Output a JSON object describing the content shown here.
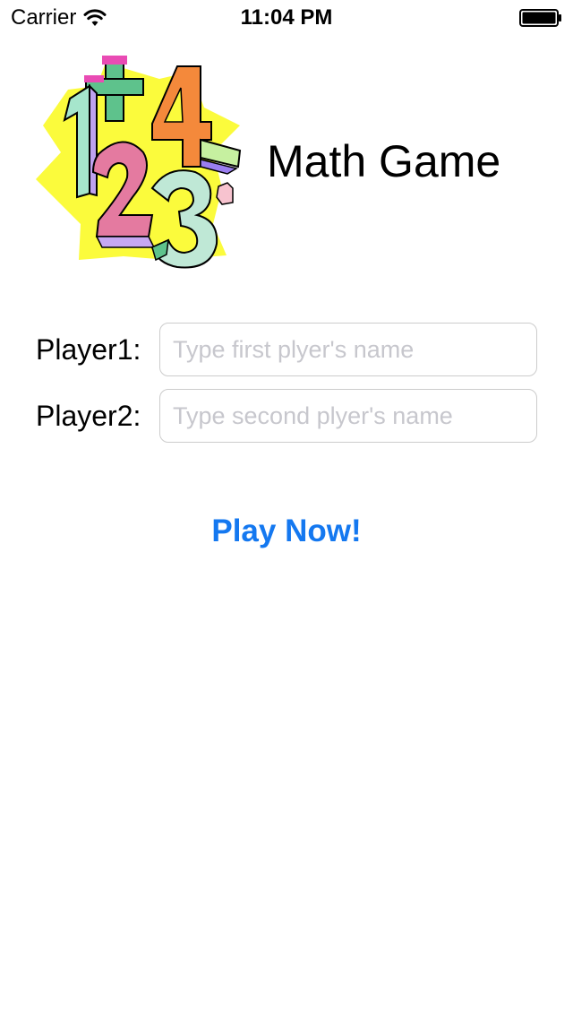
{
  "status_bar": {
    "carrier": "Carrier",
    "time": "11:04 PM",
    "wifi_icon": "wifi-icon",
    "battery_icon": "battery-full-icon"
  },
  "header": {
    "title": "Math Game",
    "logo": "math-numbers-logo"
  },
  "form": {
    "player1": {
      "label": "Player1:",
      "value": "",
      "placeholder": "Type first plyer's name"
    },
    "player2": {
      "label": "Player2:",
      "value": "",
      "placeholder": "Type second plyer's name"
    }
  },
  "actions": {
    "play_label": "Play Now!"
  },
  "colors": {
    "accent": "#1478f0",
    "background": "#ffffff",
    "placeholder": "#c7c7cd",
    "input_border": "#cccccc"
  }
}
